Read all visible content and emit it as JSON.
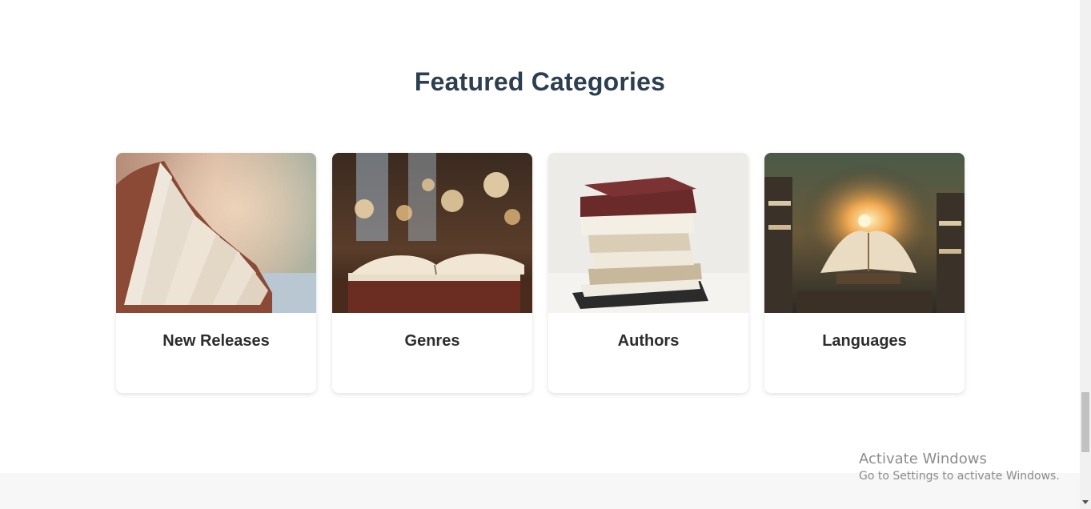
{
  "section": {
    "title": "Featured Categories"
  },
  "categories": [
    {
      "title": "New Releases",
      "image": "open-book-pages-photo"
    },
    {
      "title": "Genres",
      "image": "book-on-table-bokeh-photo"
    },
    {
      "title": "Authors",
      "image": "stacked-books-photo"
    },
    {
      "title": "Languages",
      "image": "glowing-open-book-photo"
    }
  ],
  "watermark": {
    "title": "Activate Windows",
    "subtitle": "Go to Settings to activate Windows."
  },
  "colors": {
    "heading": "#2c3e50",
    "card_title": "#2d2d2d",
    "footer_bg": "#f7f7f7"
  }
}
